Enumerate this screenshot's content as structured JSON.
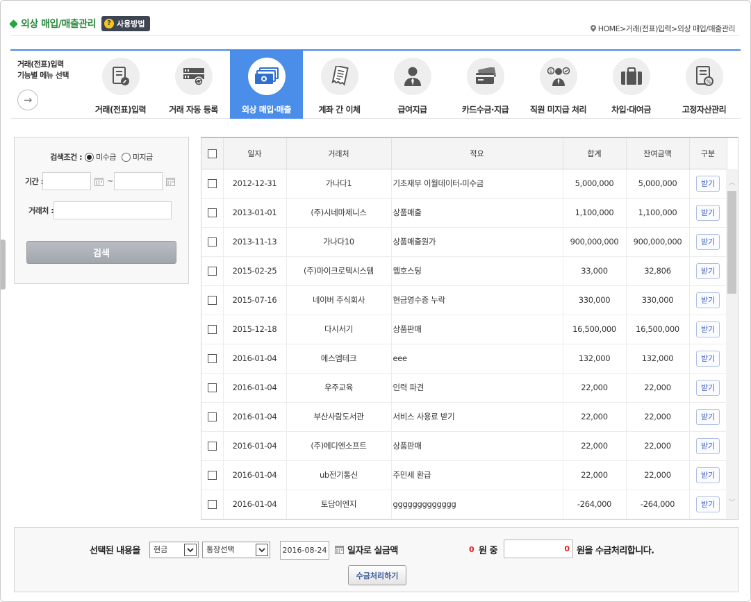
{
  "header": {
    "title": "외상 매입/매출관리",
    "help_label": "사용방법",
    "breadcrumb": [
      "HOME",
      "거래(전표)입력",
      "외상 매입/매출관리"
    ]
  },
  "menu": {
    "select_label_line1": "거래(전표)입력",
    "select_label_line2": "기능별 메뉴 선택",
    "items": [
      {
        "label": "거래(전표)입력",
        "icon": "document-pen-icon"
      },
      {
        "label": "거래 자동 등록",
        "icon": "server-sync-icon"
      },
      {
        "label": "외상 매입·매출",
        "icon": "cash-stack-icon",
        "active": true
      },
      {
        "label": "계좌 간 이체",
        "icon": "receipt-icon"
      },
      {
        "label": "급여지급",
        "icon": "person-icon"
      },
      {
        "label": "카드수금·지급",
        "icon": "credit-card-icon"
      },
      {
        "label": "직원 미지급 처리",
        "icon": "employee-money-icon"
      },
      {
        "label": "차입·대여금",
        "icon": "briefcase-icon"
      },
      {
        "label": "고정자산관리",
        "icon": "asset-document-icon"
      }
    ]
  },
  "search": {
    "condition_label": "검색조건 :",
    "option_receivable": "미수금",
    "option_payable": "미지급",
    "selected_option": "미수금",
    "period_label": "기간 :",
    "tilde": "~",
    "client_label": "거래처 :",
    "search_button": "검색"
  },
  "table": {
    "headers": [
      "일자",
      "거래처",
      "적요",
      "합계",
      "잔여금액",
      "구분"
    ],
    "action_label": "받기",
    "rows": [
      {
        "date": "2012-12-31",
        "client": "가나다1",
        "memo": "기초재무 이월데이터-미수금",
        "total": "5,000,000",
        "balance": "5,000,000"
      },
      {
        "date": "2013-01-01",
        "client": "(주)시네마제니스",
        "memo": "상품매출",
        "total": "1,100,000",
        "balance": "1,100,000"
      },
      {
        "date": "2013-11-13",
        "client": "가나다10",
        "memo": "상품매출원가",
        "total": "900,000,000",
        "balance": "900,000,000"
      },
      {
        "date": "2015-02-25",
        "client": "(주)마이크로텍시스템",
        "memo": "웹호스팅",
        "total": "33,000",
        "balance": "32,806"
      },
      {
        "date": "2015-07-16",
        "client": "네이버 주식회사",
        "memo": "현금영수증 누락",
        "total": "330,000",
        "balance": "330,000"
      },
      {
        "date": "2015-12-18",
        "client": "다시서기",
        "memo": "상품판매",
        "total": "16,500,000",
        "balance": "16,500,000"
      },
      {
        "date": "2016-01-04",
        "client": "에스엠테크",
        "memo": "eee",
        "total": "132,000",
        "balance": "132,000"
      },
      {
        "date": "2016-01-04",
        "client": "우주교육",
        "memo": "인력 파견",
        "total": "22,000",
        "balance": "22,000"
      },
      {
        "date": "2016-01-04",
        "client": "부산사람도서관",
        "memo": "서비스 사용료 받기",
        "total": "22,000",
        "balance": "22,000"
      },
      {
        "date": "2016-01-04",
        "client": "(주)메디앤소프트",
        "memo": "상품판매",
        "total": "22,000",
        "balance": "22,000"
      },
      {
        "date": "2016-01-04",
        "client": "ub전기통신",
        "memo": "주민세 환급",
        "total": "22,000",
        "balance": "22,000"
      },
      {
        "date": "2016-01-04",
        "client": "토담이엔지",
        "memo": "ggggggggggggg",
        "total": "-264,000",
        "balance": "-264,000"
      }
    ]
  },
  "bottom": {
    "selected_label": "선택된 내용을",
    "payment_type": "현금",
    "account_select": "통장선택",
    "date": "2016-08-24",
    "date_suffix": "일자로 실금액",
    "total_count": "0",
    "won_of": "원 중",
    "amount_value": "0",
    "suffix": "원을 수금처리합니다.",
    "process_button": "수금처리하기"
  }
}
